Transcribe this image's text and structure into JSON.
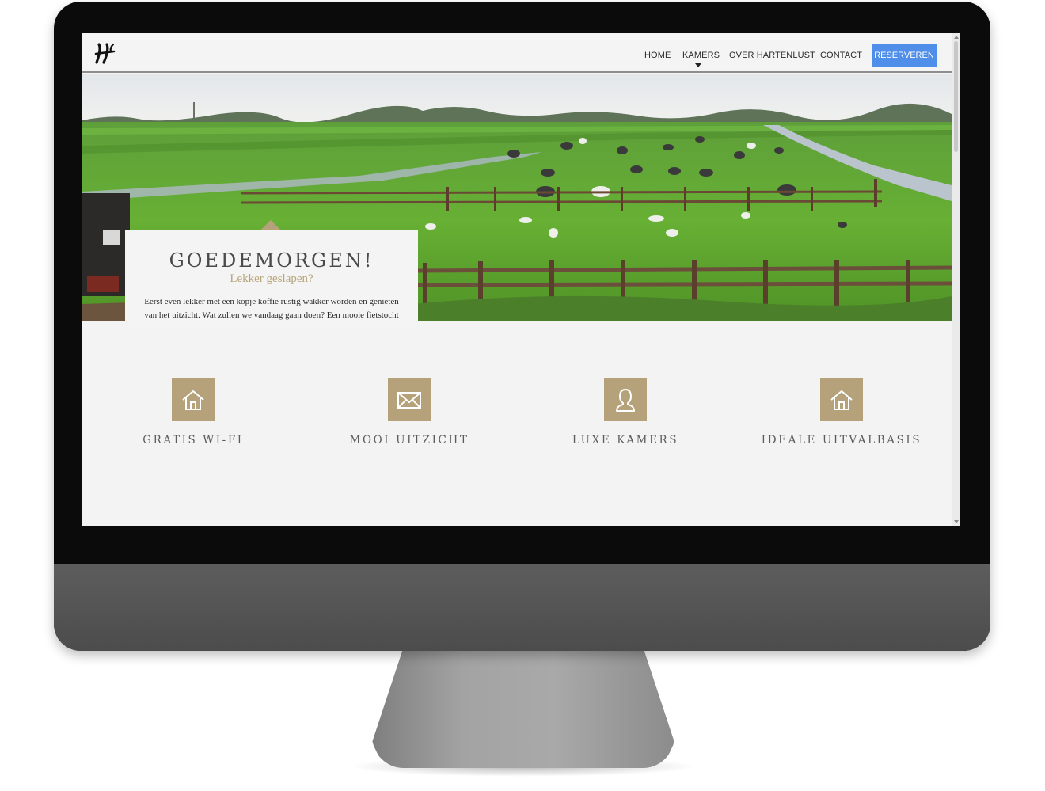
{
  "nav": {
    "items": [
      {
        "label": "HOME"
      },
      {
        "label": "KAMERS"
      },
      {
        "label": "OVER HARTENLUST"
      },
      {
        "label": "CONTACT"
      }
    ],
    "cta_label": "RESERVEREN"
  },
  "hero": {
    "title": "GOEDEMORGEN!",
    "subtitle": "Lekker geslapen?",
    "body": "Eerst even lekker met een kopje koffie rustig wakker worden en genieten van het uitzicht. Wat zullen we vandaag gaan doen? Een mooie fietstocht maken? Een mooie stad bezoeken?"
  },
  "features": [
    {
      "label": "GRATIS WI-FI",
      "icon": "home-icon"
    },
    {
      "label": "MOOI UITZICHT",
      "icon": "envelope-icon"
    },
    {
      "label": "LUXE KAMERS",
      "icon": "person-icon"
    },
    {
      "label": "IDEALE UITVALBASIS",
      "icon": "home-icon"
    }
  ],
  "colors": {
    "accent": "#b5a27a",
    "cta": "#4f8ee9",
    "background": "#f3f3f3",
    "monitor_bezel": "#0b0b0b",
    "monitor_chin": "#555555"
  }
}
